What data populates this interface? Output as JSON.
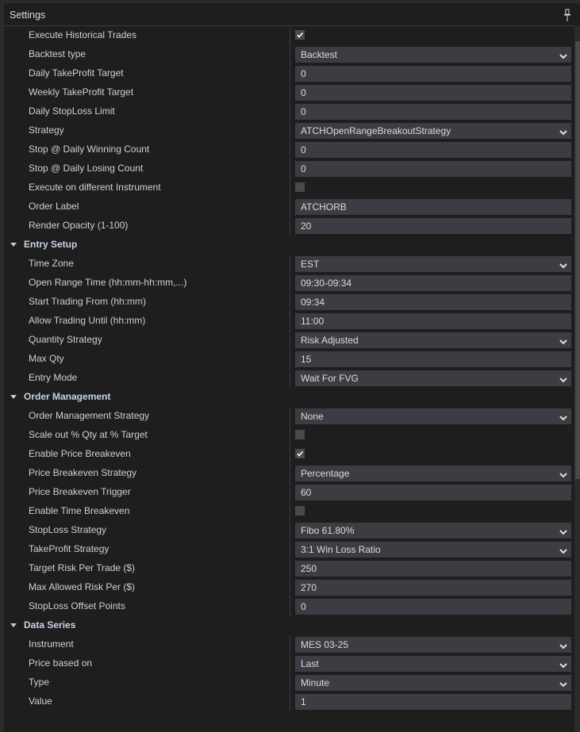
{
  "window": {
    "title": "Settings",
    "pin_icon": "pin-icon"
  },
  "groups": [
    {
      "header": null,
      "rows": [
        {
          "label": "Execute Historical Trades",
          "type": "checkbox",
          "checked": true
        },
        {
          "label": "Backtest type",
          "type": "dropdown",
          "value": "Backtest"
        },
        {
          "label": "Daily TakeProfit Target",
          "type": "text",
          "value": "0"
        },
        {
          "label": "Weekly TakeProfit Target",
          "type": "text",
          "value": "0"
        },
        {
          "label": "Daily StopLoss Limit",
          "type": "text",
          "value": "0"
        },
        {
          "label": "Strategy",
          "type": "dropdown",
          "value": "ATCHOpenRangeBreakoutStrategy"
        },
        {
          "label": "Stop @ Daily Winning Count",
          "type": "text",
          "value": "0"
        },
        {
          "label": "Stop @ Daily Losing Count",
          "type": "text",
          "value": "0"
        },
        {
          "label": "Execute on different Instrument",
          "type": "checkbox",
          "checked": false
        },
        {
          "label": "Order Label",
          "type": "text",
          "value": "ATCHORB"
        },
        {
          "label": "Render Opacity (1-100)",
          "type": "text",
          "value": "20"
        }
      ]
    },
    {
      "header": "Entry Setup",
      "rows": [
        {
          "label": "Time Zone",
          "type": "dropdown",
          "value": "EST"
        },
        {
          "label": "Open Range Time (hh:mm-hh:mm,...)",
          "type": "text",
          "value": "09:30-09:34"
        },
        {
          "label": "Start Trading From (hh:mm)",
          "type": "text",
          "value": "09:34"
        },
        {
          "label": "Allow Trading Until (hh:mm)",
          "type": "text",
          "value": "11:00"
        },
        {
          "label": "Quantity Strategy",
          "type": "dropdown",
          "value": "Risk Adjusted"
        },
        {
          "label": "Max Qty",
          "type": "text",
          "value": "15"
        },
        {
          "label": "Entry Mode",
          "type": "dropdown",
          "value": "Wait For FVG"
        }
      ]
    },
    {
      "header": "Order Management",
      "rows": [
        {
          "label": "Order Management Strategy",
          "type": "dropdown",
          "value": "None"
        },
        {
          "label": "Scale out % Qty at % Target",
          "type": "checkbox",
          "checked": false
        },
        {
          "label": "Enable Price Breakeven",
          "type": "checkbox",
          "checked": true
        },
        {
          "label": "Price Breakeven Strategy",
          "type": "dropdown",
          "value": "Percentage"
        },
        {
          "label": "Price Breakeven Trigger",
          "type": "text",
          "value": "60"
        },
        {
          "label": "Enable Time Breakeven",
          "type": "checkbox",
          "checked": false
        },
        {
          "label": "StopLoss Strategy",
          "type": "dropdown",
          "value": "Fibo 61.80%"
        },
        {
          "label": "TakeProfit Strategy",
          "type": "dropdown",
          "value": "3:1 Win Loss Ratio"
        },
        {
          "label": "Target Risk Per Trade ($)",
          "type": "text",
          "value": "250"
        },
        {
          "label": "Max Allowed Risk Per ($)",
          "type": "text",
          "value": "270"
        },
        {
          "label": "StopLoss Offset Points",
          "type": "text",
          "value": "0"
        }
      ]
    },
    {
      "header": "Data Series",
      "rows": [
        {
          "label": "Instrument",
          "type": "dropdown",
          "value": "MES 03-25"
        },
        {
          "label": "Price based on",
          "type": "dropdown",
          "value": "Last"
        },
        {
          "label": "Type",
          "type": "dropdown",
          "value": "Minute"
        },
        {
          "label": "Value",
          "type": "text",
          "value": "1"
        }
      ]
    }
  ],
  "scrollbar": {
    "visible_fraction": 0.62,
    "position": 0.0
  }
}
